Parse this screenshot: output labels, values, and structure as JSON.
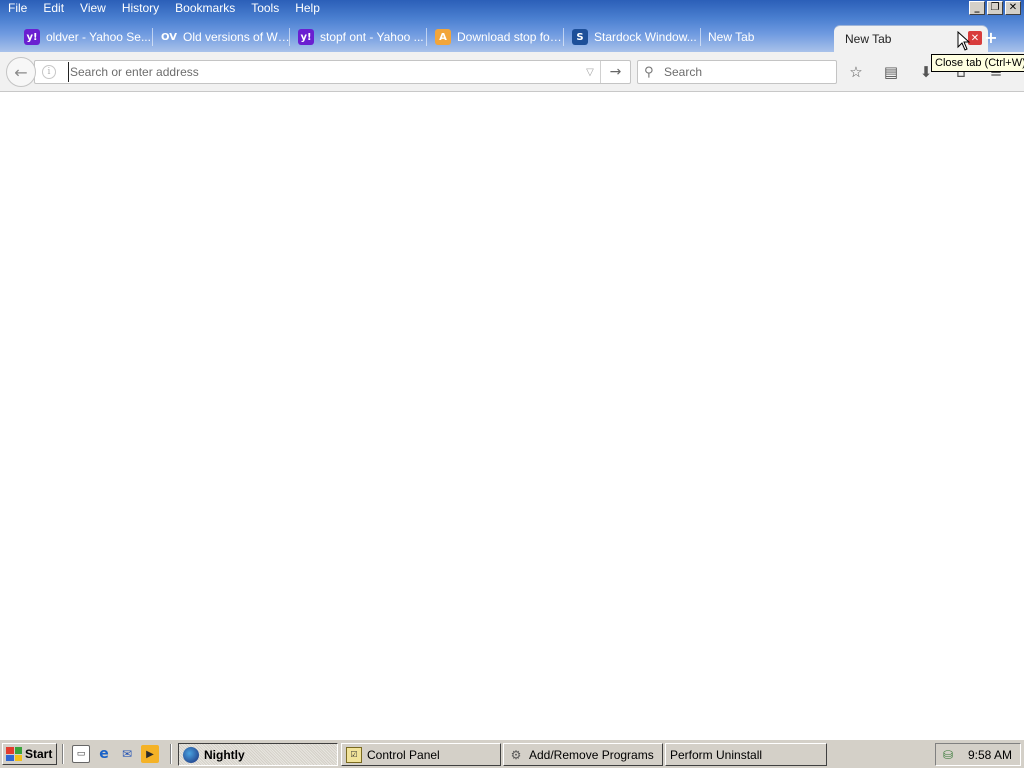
{
  "menubar": {
    "items": [
      "File",
      "Edit",
      "View",
      "History",
      "Bookmarks",
      "Tools",
      "Help"
    ]
  },
  "window_controls": {
    "minimize": "_",
    "restore": "❐",
    "close": "✕"
  },
  "tabs": [
    {
      "label": "oldver - Yahoo Se...",
      "icon": "yahoo-icon",
      "glyph": "y!"
    },
    {
      "label": "Old versions of Wi...",
      "icon": "oldversion-icon",
      "glyph": "OV"
    },
    {
      "label": "stopf ont - Yahoo ...",
      "icon": "yahoo-icon",
      "glyph": "y!"
    },
    {
      "label": "Download stop fon...",
      "icon": "font-site-icon",
      "glyph": "A"
    },
    {
      "label": "Stardock Window...",
      "icon": "stardock-icon",
      "glyph": "S"
    },
    {
      "label": "New Tab",
      "icon": "",
      "glyph": ""
    }
  ],
  "active_tab": {
    "label": "New Tab",
    "close_glyph": "✕"
  },
  "new_tab_glyph": "+",
  "tooltip": "Close tab (Ctrl+W)",
  "navbar": {
    "back_glyph": "←",
    "info_glyph": "i",
    "url_value": "",
    "url_placeholder": "Search or enter address",
    "dropmarker_glyph": "▽",
    "go_glyph": "→",
    "search_glyph": "⚲",
    "search_placeholder": "Search",
    "icons": [
      {
        "name": "bookmark-star-icon",
        "glyph": "☆"
      },
      {
        "name": "reading-list-icon",
        "glyph": "▤"
      },
      {
        "name": "downloads-icon",
        "glyph": "⬇"
      },
      {
        "name": "home-icon",
        "glyph": "⌂"
      },
      {
        "name": "menu-icon",
        "glyph": "≡"
      }
    ]
  },
  "taskbar": {
    "start_label": "Start",
    "quicklaunch": [
      {
        "name": "show-desktop-icon",
        "glyph": "▭"
      },
      {
        "name": "internet-explorer-icon",
        "glyph": "e"
      },
      {
        "name": "outlook-express-icon",
        "glyph": "✉"
      },
      {
        "name": "media-player-icon",
        "glyph": "▶"
      }
    ],
    "tasks": [
      {
        "label": "Nightly",
        "icon_glyph": ""
      },
      {
        "label": "Control Panel",
        "icon_glyph": "☑"
      },
      {
        "label": "Add/Remove Programs",
        "icon_glyph": "⚙"
      },
      {
        "label": "Perform Uninstall",
        "icon_glyph": ""
      }
    ],
    "tray_glyph": "⛁",
    "clock": "9:58 AM"
  },
  "colors": {
    "titlebar_top": "#2b5fb8",
    "titlebar_bottom": "#a9c2ea",
    "toolbar_bg": "#f1f1f1",
    "taskbar_bg": "#d4d0c8",
    "tooltip_bg": "#ffffe1"
  }
}
